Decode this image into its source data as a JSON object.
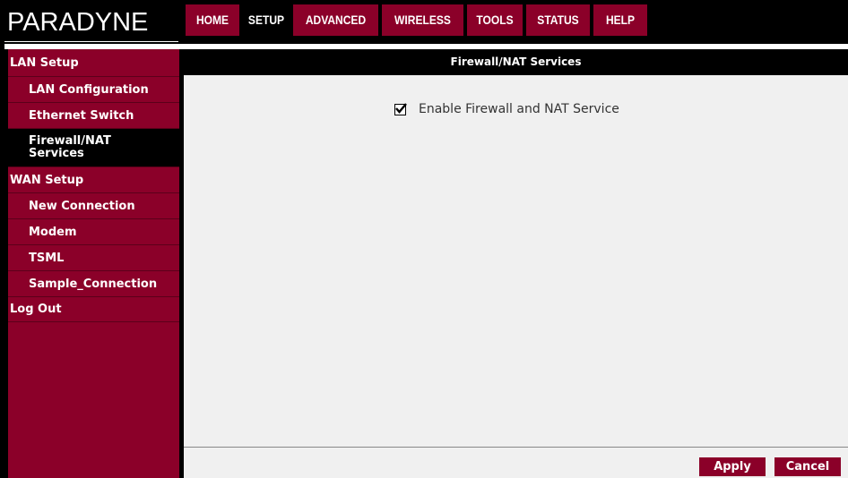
{
  "brand": {
    "logo_text": "PARADYNE"
  },
  "nav": {
    "tabs": [
      {
        "label": "HOME",
        "active": false
      },
      {
        "label": "SETUP",
        "active": true
      },
      {
        "label": "ADVANCED",
        "active": false
      },
      {
        "label": "WIRELESS",
        "active": false
      },
      {
        "label": "TOOLS",
        "active": false
      },
      {
        "label": "STATUS",
        "active": false
      },
      {
        "label": "HELP",
        "active": false
      }
    ]
  },
  "sidebar": {
    "items": [
      {
        "label": "LAN Setup",
        "level": "top"
      },
      {
        "label": "LAN Configuration",
        "level": "sub"
      },
      {
        "label": "Ethernet Switch",
        "level": "sub"
      },
      {
        "label": "Firewall/NAT Services",
        "level": "sub",
        "active": true
      },
      {
        "label": "WAN Setup",
        "level": "top"
      },
      {
        "label": "New Connection",
        "level": "sub"
      },
      {
        "label": "Modem",
        "level": "sub"
      },
      {
        "label": "TSML",
        "level": "sub"
      },
      {
        "label": "Sample_Connection",
        "level": "sub"
      },
      {
        "label": "Log Out",
        "level": "top"
      }
    ]
  },
  "main": {
    "section_title": "Firewall/NAT Services",
    "enable_label": "Enable Firewall and NAT Service",
    "enable_checked": true
  },
  "buttons": {
    "apply": "Apply",
    "cancel": "Cancel"
  },
  "colors": {
    "accent": "#8b0029",
    "background": "#f0f0f0",
    "header": "#000000"
  }
}
